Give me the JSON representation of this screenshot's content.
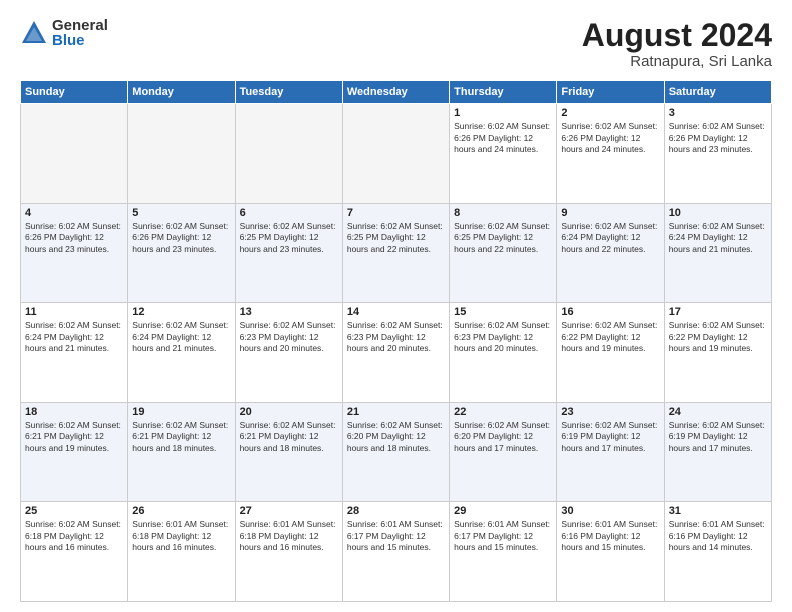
{
  "logo": {
    "general": "General",
    "blue": "Blue"
  },
  "title": "August 2024",
  "subtitle": "Ratnapura, Sri Lanka",
  "days_header": [
    "Sunday",
    "Monday",
    "Tuesday",
    "Wednesday",
    "Thursday",
    "Friday",
    "Saturday"
  ],
  "weeks": [
    [
      {
        "day": "",
        "info": ""
      },
      {
        "day": "",
        "info": ""
      },
      {
        "day": "",
        "info": ""
      },
      {
        "day": "",
        "info": ""
      },
      {
        "day": "1",
        "info": "Sunrise: 6:02 AM\nSunset: 6:26 PM\nDaylight: 12 hours\nand 24 minutes."
      },
      {
        "day": "2",
        "info": "Sunrise: 6:02 AM\nSunset: 6:26 PM\nDaylight: 12 hours\nand 24 minutes."
      },
      {
        "day": "3",
        "info": "Sunrise: 6:02 AM\nSunset: 6:26 PM\nDaylight: 12 hours\nand 23 minutes."
      }
    ],
    [
      {
        "day": "4",
        "info": "Sunrise: 6:02 AM\nSunset: 6:26 PM\nDaylight: 12 hours\nand 23 minutes."
      },
      {
        "day": "5",
        "info": "Sunrise: 6:02 AM\nSunset: 6:26 PM\nDaylight: 12 hours\nand 23 minutes."
      },
      {
        "day": "6",
        "info": "Sunrise: 6:02 AM\nSunset: 6:25 PM\nDaylight: 12 hours\nand 23 minutes."
      },
      {
        "day": "7",
        "info": "Sunrise: 6:02 AM\nSunset: 6:25 PM\nDaylight: 12 hours\nand 22 minutes."
      },
      {
        "day": "8",
        "info": "Sunrise: 6:02 AM\nSunset: 6:25 PM\nDaylight: 12 hours\nand 22 minutes."
      },
      {
        "day": "9",
        "info": "Sunrise: 6:02 AM\nSunset: 6:24 PM\nDaylight: 12 hours\nand 22 minutes."
      },
      {
        "day": "10",
        "info": "Sunrise: 6:02 AM\nSunset: 6:24 PM\nDaylight: 12 hours\nand 21 minutes."
      }
    ],
    [
      {
        "day": "11",
        "info": "Sunrise: 6:02 AM\nSunset: 6:24 PM\nDaylight: 12 hours\nand 21 minutes."
      },
      {
        "day": "12",
        "info": "Sunrise: 6:02 AM\nSunset: 6:24 PM\nDaylight: 12 hours\nand 21 minutes."
      },
      {
        "day": "13",
        "info": "Sunrise: 6:02 AM\nSunset: 6:23 PM\nDaylight: 12 hours\nand 20 minutes."
      },
      {
        "day": "14",
        "info": "Sunrise: 6:02 AM\nSunset: 6:23 PM\nDaylight: 12 hours\nand 20 minutes."
      },
      {
        "day": "15",
        "info": "Sunrise: 6:02 AM\nSunset: 6:23 PM\nDaylight: 12 hours\nand 20 minutes."
      },
      {
        "day": "16",
        "info": "Sunrise: 6:02 AM\nSunset: 6:22 PM\nDaylight: 12 hours\nand 19 minutes."
      },
      {
        "day": "17",
        "info": "Sunrise: 6:02 AM\nSunset: 6:22 PM\nDaylight: 12 hours\nand 19 minutes."
      }
    ],
    [
      {
        "day": "18",
        "info": "Sunrise: 6:02 AM\nSunset: 6:21 PM\nDaylight: 12 hours\nand 19 minutes."
      },
      {
        "day": "19",
        "info": "Sunrise: 6:02 AM\nSunset: 6:21 PM\nDaylight: 12 hours\nand 18 minutes."
      },
      {
        "day": "20",
        "info": "Sunrise: 6:02 AM\nSunset: 6:21 PM\nDaylight: 12 hours\nand 18 minutes."
      },
      {
        "day": "21",
        "info": "Sunrise: 6:02 AM\nSunset: 6:20 PM\nDaylight: 12 hours\nand 18 minutes."
      },
      {
        "day": "22",
        "info": "Sunrise: 6:02 AM\nSunset: 6:20 PM\nDaylight: 12 hours\nand 17 minutes."
      },
      {
        "day": "23",
        "info": "Sunrise: 6:02 AM\nSunset: 6:19 PM\nDaylight: 12 hours\nand 17 minutes."
      },
      {
        "day": "24",
        "info": "Sunrise: 6:02 AM\nSunset: 6:19 PM\nDaylight: 12 hours\nand 17 minutes."
      }
    ],
    [
      {
        "day": "25",
        "info": "Sunrise: 6:02 AM\nSunset: 6:18 PM\nDaylight: 12 hours\nand 16 minutes."
      },
      {
        "day": "26",
        "info": "Sunrise: 6:01 AM\nSunset: 6:18 PM\nDaylight: 12 hours\nand 16 minutes."
      },
      {
        "day": "27",
        "info": "Sunrise: 6:01 AM\nSunset: 6:18 PM\nDaylight: 12 hours\nand 16 minutes."
      },
      {
        "day": "28",
        "info": "Sunrise: 6:01 AM\nSunset: 6:17 PM\nDaylight: 12 hours\nand 15 minutes."
      },
      {
        "day": "29",
        "info": "Sunrise: 6:01 AM\nSunset: 6:17 PM\nDaylight: 12 hours\nand 15 minutes."
      },
      {
        "day": "30",
        "info": "Sunrise: 6:01 AM\nSunset: 6:16 PM\nDaylight: 12 hours\nand 15 minutes."
      },
      {
        "day": "31",
        "info": "Sunrise: 6:01 AM\nSunset: 6:16 PM\nDaylight: 12 hours\nand 14 minutes."
      }
    ]
  ]
}
